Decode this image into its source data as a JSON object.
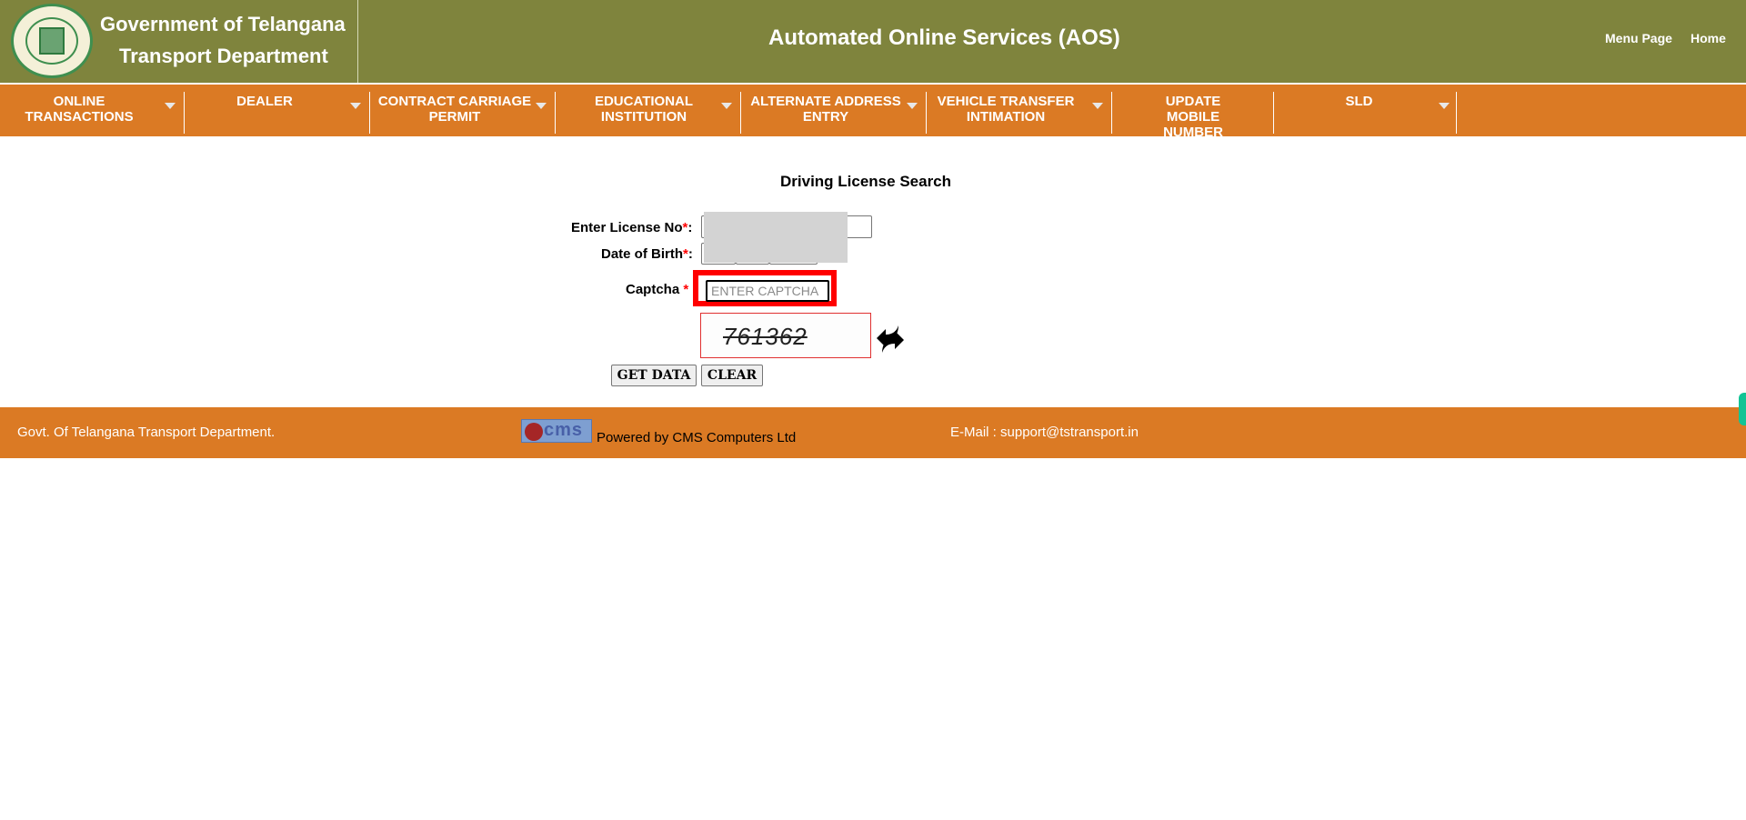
{
  "header": {
    "logo_line1": "Government of Telangana",
    "logo_line2": "Transport Department",
    "app_title": "Automated Online Services (AOS)",
    "links": [
      "Menu Page",
      "Home"
    ]
  },
  "nav": {
    "items": [
      {
        "label": "ONLINE TRANSACTIONS",
        "has_dropdown": true
      },
      {
        "label": "DEALER",
        "has_dropdown": true
      },
      {
        "label": "CONTRACT CARRIAGE PERMIT",
        "has_dropdown": true
      },
      {
        "label": "EDUCATIONAL INSTITUTION",
        "has_dropdown": true
      },
      {
        "label": "ALTERNATE ADDRESS ENTRY",
        "has_dropdown": true
      },
      {
        "label": "VEHICLE TRANSFER INTIMATION",
        "has_dropdown": true
      },
      {
        "label": "UPDATE MOBILE NUMBER",
        "has_dropdown": false
      },
      {
        "label": "SLD",
        "has_dropdown": true
      }
    ]
  },
  "form": {
    "title": "Driving License Search",
    "license_label": "Enter License No",
    "dob_label": "Date of Birth",
    "captcha_label": "Captcha",
    "required_mark": "*",
    "colon": ":",
    "captcha_placeholder": "ENTER CAPTCHA",
    "captcha_value": "",
    "captcha_code": "761362",
    "get_data_label": "GET DATA",
    "clear_label": "CLEAR"
  },
  "footer": {
    "left": "Govt. Of Telangana Transport Department.",
    "cms_logo_text": "cms",
    "powered_by": "Powered by CMS Computers Ltd",
    "email": "E-Mail : support@tstransport.in"
  },
  "colors": {
    "header_bg": "#7f843d",
    "nav_bg": "#db7a24",
    "highlight": "#ff0000"
  }
}
